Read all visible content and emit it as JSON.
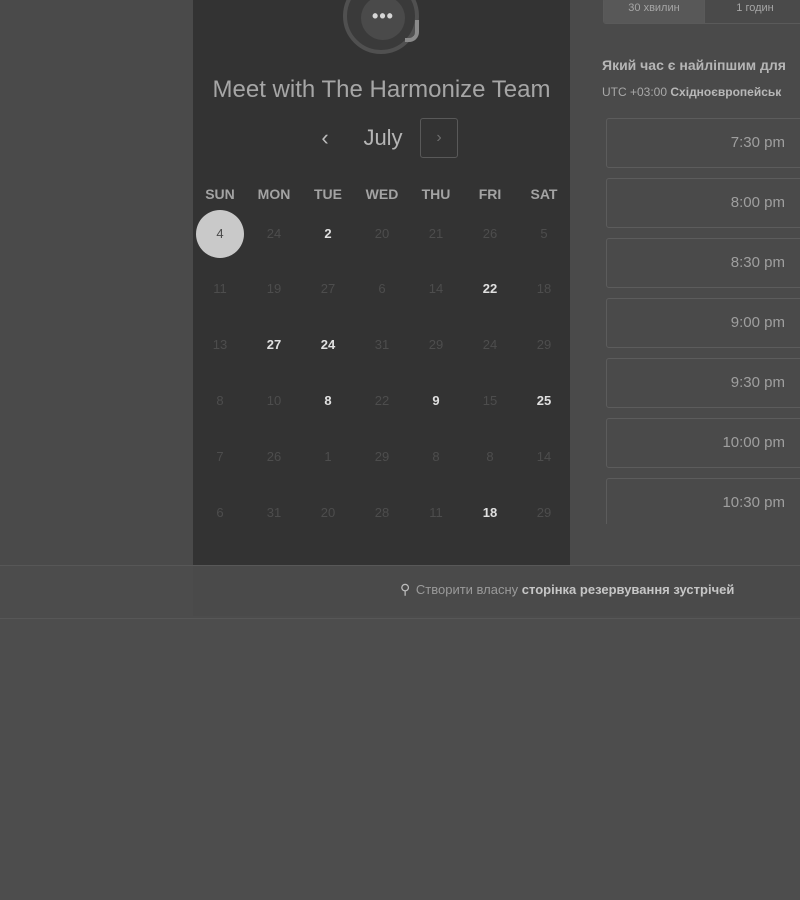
{
  "header": {
    "title": "Meet with The Harmonize Team",
    "logo_glyph": "•••",
    "logo_icon": "chat-bubble-icon"
  },
  "calendar": {
    "month": "July",
    "prev_glyph": "‹",
    "next_glyph": "›",
    "weekdays": [
      "SUN",
      "MON",
      "TUE",
      "WED",
      "THU",
      "FRI",
      "SAT"
    ],
    "weeks": [
      [
        "4",
        "24",
        "2",
        "20",
        "21",
        "26",
        "5"
      ],
      [
        "11",
        "19",
        "27",
        "6",
        "14",
        "22",
        "18"
      ],
      [
        "13",
        "27",
        "24",
        "31",
        "29",
        "24",
        "29"
      ],
      [
        "8",
        "10",
        "8",
        "22",
        "9",
        "15",
        "25"
      ],
      [
        "7",
        "26",
        "1",
        "29",
        "8",
        "8",
        "14"
      ],
      [
        "6",
        "31",
        "20",
        "28",
        "11",
        "18",
        "29"
      ]
    ],
    "available": [
      [
        false,
        false,
        true,
        false,
        false,
        false,
        false
      ],
      [
        false,
        false,
        false,
        false,
        false,
        true,
        false
      ],
      [
        false,
        true,
        true,
        false,
        false,
        false,
        false
      ],
      [
        false,
        false,
        true,
        false,
        true,
        false,
        true
      ],
      [
        false,
        false,
        false,
        false,
        false,
        false,
        false
      ],
      [
        false,
        false,
        false,
        false,
        false,
        true,
        false
      ]
    ],
    "selected": {
      "week": 0,
      "day": 0
    }
  },
  "durations": [
    {
      "label": "30 хвилин",
      "active": true
    },
    {
      "label": "1 годин",
      "active": false
    }
  ],
  "slots_panel": {
    "question": "Який час є найліпшим для",
    "tz_offset": "UTC +03:00",
    "tz_name": "Східноєвропейськ",
    "times": [
      "7:30 pm",
      "8:00 pm",
      "8:30 pm",
      "9:00 pm",
      "9:30 pm",
      "10:00 pm",
      "10:30 pm"
    ]
  },
  "footer": {
    "icon": "magic-wand-icon",
    "icon_glyph": "⚲",
    "prefix": "Створити власну",
    "bold": "сторінка резервування зустрічей"
  },
  "colors": {
    "overlay_dim": "#4d4d4d",
    "panel_dark": "#333333",
    "selected_bubble": "#c9c9c9"
  }
}
